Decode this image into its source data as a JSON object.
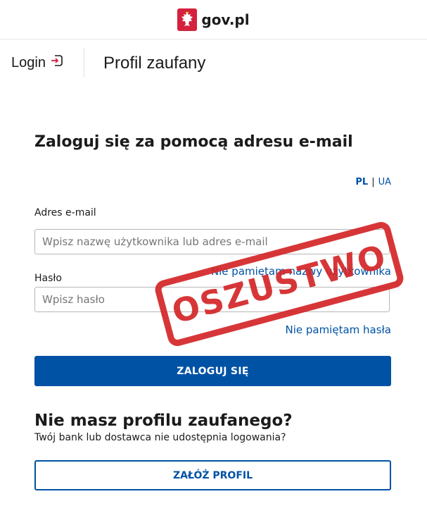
{
  "header": {
    "brand": "gov.pl",
    "logo_icon": "polish-eagle-emblem"
  },
  "subheader": {
    "login_label": "Login",
    "login_icon": "login-arrow-icon",
    "service_name": "Profil zaufany"
  },
  "form": {
    "heading": "Zaloguj się za pomocą adresu e-mail",
    "lang": {
      "pl": "PL",
      "ua": "UA",
      "active": "PL"
    },
    "email_label": "Adres e-mail",
    "email_placeholder": "Wpisz nazwę użytkownika lub adres e-mail",
    "forgot_username": "Nie pamiętam nazwy użytkownika",
    "password_label": "Hasło",
    "password_placeholder": "Wpisz hasło",
    "forgot_password": "Nie pamiętam hasła",
    "submit_label": "ZALOGUJ SIĘ"
  },
  "register": {
    "heading": "Nie masz profilu zaufanego?",
    "subtext": "Twój bank lub dostawca nie udostępnia logowania?",
    "button_label": "ZAŁÓŻ PROFIL"
  },
  "stamp": {
    "text": "OSZUSTWO",
    "color": "#d42628"
  },
  "colors": {
    "primary": "#0052a5",
    "emblem": "#d4213d"
  }
}
